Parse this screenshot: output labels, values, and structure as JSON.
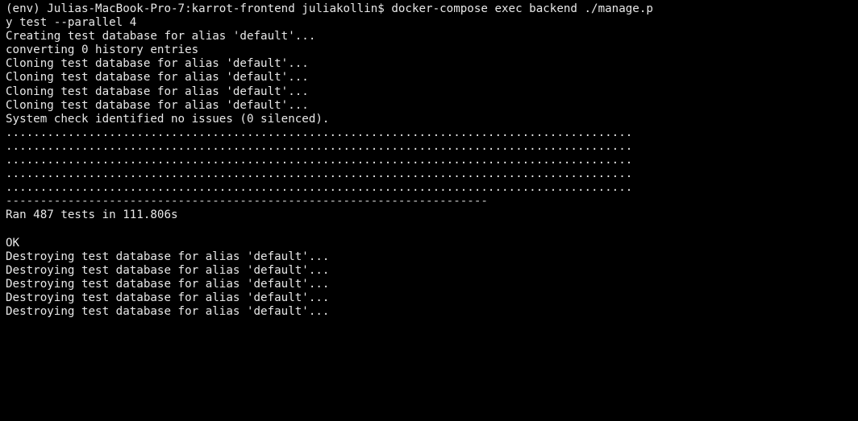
{
  "terminal": {
    "lines": [
      "(env) Julias-MacBook-Pro-7:karrot-frontend juliakollin$ docker-compose exec backend ./manage.p",
      "y test --parallel 4",
      "Creating test database for alias 'default'...",
      "converting 0 history entries",
      "Cloning test database for alias 'default'...",
      "Cloning test database for alias 'default'...",
      "Cloning test database for alias 'default'...",
      "Cloning test database for alias 'default'...",
      "System check identified no issues (0 silenced).",
      "...........................................................................................",
      "...........................................................................................",
      "...........................................................................................",
      "...........................................................................................",
      "...........................................................................................",
      "----------------------------------------------------------------------",
      "Ran 487 tests in 111.806s",
      "",
      "OK",
      "Destroying test database for alias 'default'...",
      "Destroying test database for alias 'default'...",
      "Destroying test database for alias 'default'...",
      "Destroying test database for alias 'default'...",
      "Destroying test database for alias 'default'..."
    ]
  }
}
